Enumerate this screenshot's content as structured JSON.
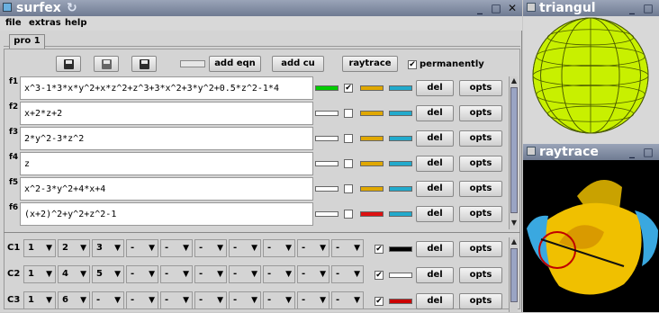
{
  "main_window": {
    "title": "surfex",
    "menu": [
      "file",
      "extras",
      "help"
    ],
    "tab": "pro 1",
    "toolbar": {
      "add_eqn": "add eqn",
      "add_cu": "add cu",
      "raytrace": "raytrace",
      "permanently": "permanently",
      "permanently_checked": true
    },
    "equations": [
      {
        "label": "f1",
        "text": "x^3-1*3*x*y^2+x*z^2+z^3+3*x^2+3*y^2+0.5*z^2-1*4",
        "visible": true,
        "color1": "#00cc00",
        "color2": "#e0a800",
        "color3": "#22aacc",
        "del": "del",
        "opts": "opts"
      },
      {
        "label": "f2",
        "text": "x+2*z+2",
        "visible": false,
        "color1": "#ffffff",
        "color2": "#e0a800",
        "color3": "#22aacc",
        "del": "del",
        "opts": "opts"
      },
      {
        "label": "f3",
        "text": "2*y^2-3*z^2",
        "visible": false,
        "color1": "#ffffff",
        "color2": "#e0a800",
        "color3": "#22aacc",
        "del": "del",
        "opts": "opts"
      },
      {
        "label": "f4",
        "text": "z",
        "visible": false,
        "color1": "#ffffff",
        "color2": "#e0a800",
        "color3": "#22aacc",
        "del": "del",
        "opts": "opts"
      },
      {
        "label": "f5",
        "text": "x^2-3*y^2+4*x+4",
        "visible": false,
        "color1": "#ffffff",
        "color2": "#e0a800",
        "color3": "#22aacc",
        "del": "del",
        "opts": "opts"
      },
      {
        "label": "f6",
        "text": "(x+2)^2+y^2+z^2-1",
        "visible": false,
        "color1": "#ffffff",
        "color2": "#dd1111",
        "color3": "#22aacc",
        "del": "del",
        "opts": "opts"
      }
    ],
    "conditions": [
      {
        "label": "C1",
        "values": [
          "1",
          "2",
          "3",
          "-",
          "-",
          "-",
          "-",
          "-",
          "-",
          "-"
        ],
        "checked": true,
        "color": "#000000",
        "del": "del",
        "opts": "opts"
      },
      {
        "label": "C2",
        "values": [
          "1",
          "4",
          "5",
          "-",
          "-",
          "-",
          "-",
          "-",
          "-",
          "-"
        ],
        "checked": true,
        "color": "#ffffff",
        "del": "del",
        "opts": "opts"
      },
      {
        "label": "C3",
        "values": [
          "1",
          "6",
          "-",
          "-",
          "-",
          "-",
          "-",
          "-",
          "-",
          "-"
        ],
        "checked": true,
        "color": "#cc0000",
        "del": "del",
        "opts": "opts"
      }
    ]
  },
  "triangulation_window": {
    "title": "triangul",
    "sphere_color": "#c8f000"
  },
  "raytrace_window": {
    "title": "raytrace",
    "surface_color": "#f0c000",
    "accent_color": "#3aa8e0"
  },
  "icons": [
    "save-icon",
    "save-as-icon",
    "save-all-icon",
    "minimize-icon",
    "maximize-icon",
    "close-icon"
  ]
}
